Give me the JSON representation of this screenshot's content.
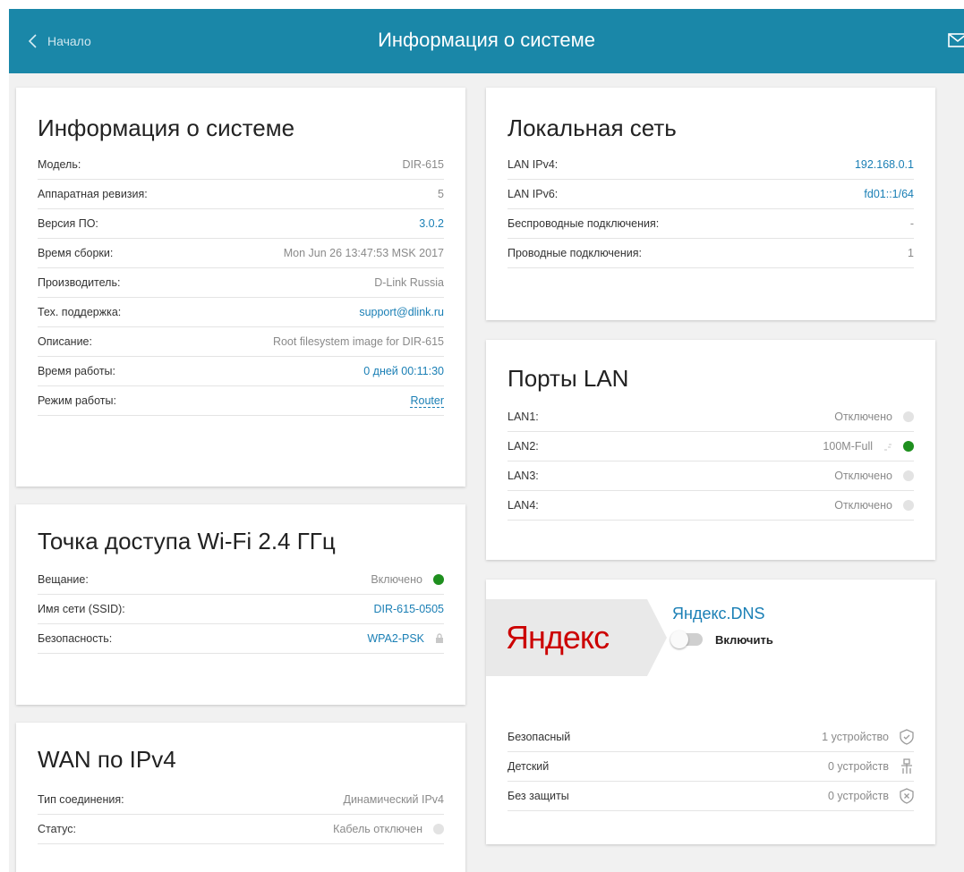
{
  "header": {
    "back_label": "Начало",
    "title": "Информация о системе"
  },
  "system": {
    "title": "Информация о системе",
    "rows": [
      {
        "key": "Модель:",
        "value": "DIR-615"
      },
      {
        "key": "Аппаратная ревизия:",
        "value": "5"
      },
      {
        "key": "Версия ПО:",
        "value": "3.0.2"
      },
      {
        "key": "Время сборки:",
        "value": "Mon Jun 26 13:47:53 MSK 2017"
      },
      {
        "key": "Производитель:",
        "value": "D-Link Russia"
      },
      {
        "key": "Тех. поддержка:",
        "value": "support@dlink.ru"
      },
      {
        "key": "Описание:",
        "value": "Root filesystem image for DIR-615"
      },
      {
        "key": "Время работы:",
        "value": "0 дней 00:11:30"
      },
      {
        "key": "Режим работы:",
        "value": "Router"
      }
    ]
  },
  "wifi": {
    "title": "Точка доступа Wi-Fi 2.4 ГГц",
    "rows": [
      {
        "key": "Вещание:",
        "value": "Включено"
      },
      {
        "key": "Имя сети (SSID):",
        "value": "DIR-615-0505"
      },
      {
        "key": "Безопасность:",
        "value": "WPA2-PSK"
      }
    ]
  },
  "wan": {
    "title": "WAN по IPv4",
    "rows": [
      {
        "key": "Тип соединения:",
        "value": "Динамический IPv4"
      },
      {
        "key": "Статус:",
        "value": "Кабель отключен"
      }
    ]
  },
  "lan": {
    "title": "Локальная сеть",
    "rows": [
      {
        "key": "LAN IPv4:",
        "value": "192.168.0.1"
      },
      {
        "key": "LAN IPv6:",
        "value": "fd01::1/64"
      },
      {
        "key": "Беспроводные подключения:",
        "value": "-"
      },
      {
        "key": "Проводные подключения:",
        "value": "1"
      }
    ]
  },
  "ports": {
    "title": "Порты LAN",
    "rows": [
      {
        "key": "LAN1:",
        "value": "Отключено"
      },
      {
        "key": "LAN2:",
        "value": "100M-Full"
      },
      {
        "key": "LAN3:",
        "value": "Отключено"
      },
      {
        "key": "LAN4:",
        "value": "Отключено"
      }
    ]
  },
  "yandex": {
    "logo_red": "Я",
    "logo_rest": "ндекс",
    "title": "Яндекс.DNS",
    "toggle_label": "Включить",
    "rows": [
      {
        "key": "Безопасный",
        "value": "1 устройство"
      },
      {
        "key": "Детский",
        "value": "0 устройств"
      },
      {
        "key": "Без защиты",
        "value": "0 устройств"
      }
    ]
  },
  "colors": {
    "header": "#1a87a8",
    "link": "#1a7fb5",
    "status_on": "#1e8f1e",
    "yandex_red": "#cc0000"
  }
}
